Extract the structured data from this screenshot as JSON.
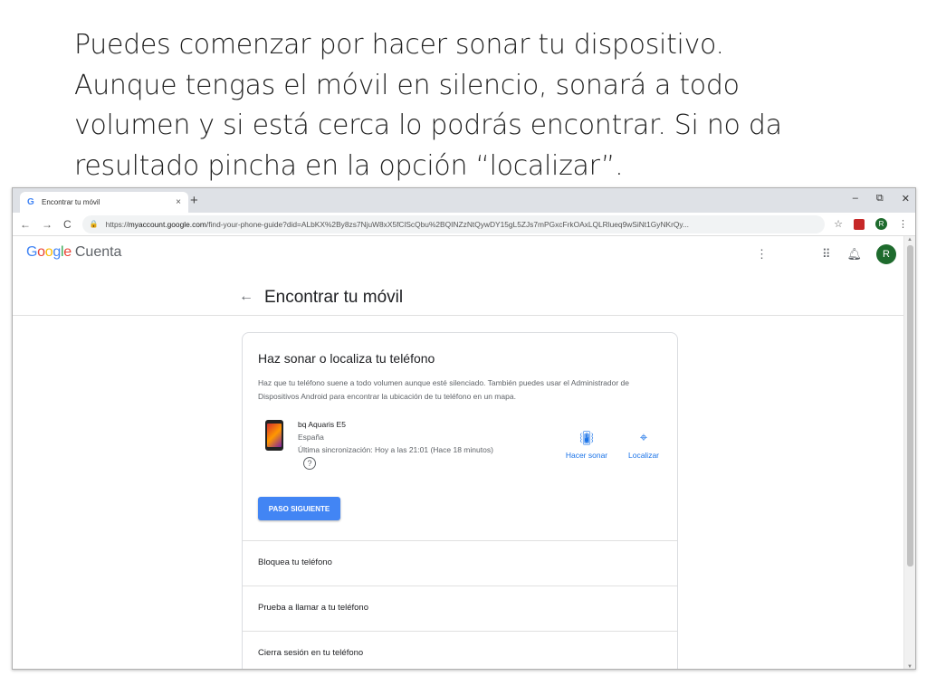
{
  "slide": {
    "line1": "Puedes comenzar por hacer sonar tu dispositivo.",
    "line2": "Aunque tengas el móvil en silencio, sonará a todo",
    "line3": "volumen y si está cerca lo podrás encontrar. Si no da",
    "line4": "resultado pincha en la opción “localizar”."
  },
  "browser": {
    "tab_title": "Encontrar tu móvil",
    "tab_close": "×",
    "new_tab": "+",
    "win_minimize": "–",
    "win_restore": "⧉",
    "win_close": "✕",
    "back": "←",
    "forward": "→",
    "reload": "C",
    "url_prefix": "https://",
    "url_host": "myaccount.google.com",
    "url_path": "/find-your-phone-guide?did=ALbKX%2By8zs7NjuW8xX5fClScQbu%2BQINZzNtQywDY15gL5ZJs7mPGxcFrkOAxLQLRlueq9wSiNt1GyNKrQy...",
    "avatar_letter": "R"
  },
  "header": {
    "logo_letters": [
      "G",
      "o",
      "o",
      "g",
      "l",
      "e"
    ],
    "logo_suffix": "Cuenta",
    "avatar_letter": "R"
  },
  "page": {
    "title": "Encontrar tu móvil",
    "card": {
      "title": "Haz sonar o localiza tu teléfono",
      "description": "Haz que tu teléfono suene a todo volumen aunque esté silenciado. También puedes usar el Administrador de Dispositivos Android para encontrar la ubicación de tu teléfono en un mapa.",
      "device_name": "bq Aquaris E5",
      "device_country": "España",
      "device_sync": "Última sincronización: Hoy a las 21:01 (Hace 18 minutos)",
      "ring_label": "Hacer sonar",
      "locate_label": "Localizar",
      "next_button": "PASO SIGUIENTE"
    },
    "list": [
      "Bloquea tu teléfono",
      "Prueba a llamar a tu teléfono",
      "Cierra sesión en tu teléfono"
    ]
  }
}
